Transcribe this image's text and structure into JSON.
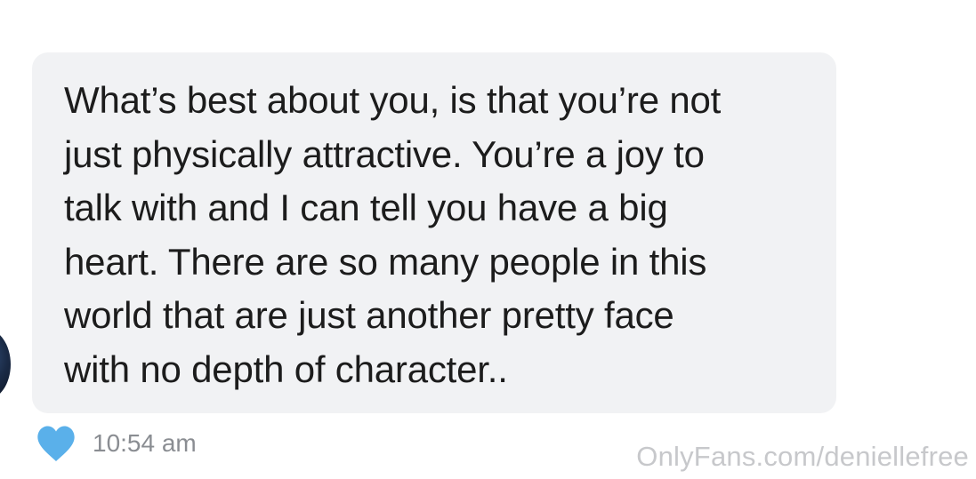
{
  "message": {
    "text": "What’s best about you, is that you’re not\njust physically attractive. You’re a joy to\ntalk with and I can tell you have a big\nheart. There are so many people in this\nworld that are just another pretty face\nwith no depth of character..",
    "timestamp": "10:54 am",
    "liked": true,
    "heart_icon": "heart-icon",
    "heart_color": "#5ab0ea",
    "bubble_color": "#f1f2f4"
  },
  "watermark": "OnlyFans.com/deniellefree"
}
